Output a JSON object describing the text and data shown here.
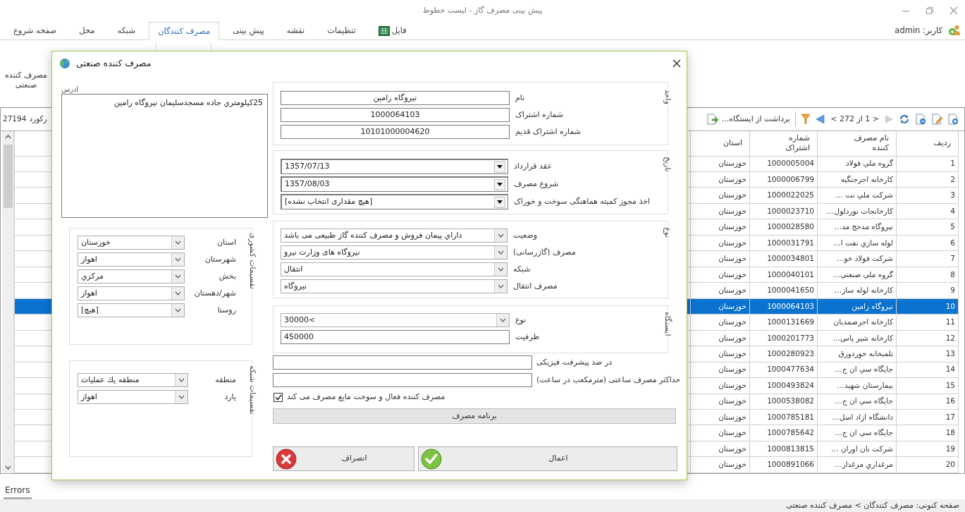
{
  "window": {
    "title": "پیش بینی مصرف گاز - لیست خطوط"
  },
  "ribbon_tabs": [
    {
      "label": "فایل",
      "kind": "file",
      "selected": false
    },
    {
      "label": "تنظیمات",
      "kind": "plain",
      "selected": false
    },
    {
      "label": "نقشه",
      "kind": "plain",
      "selected": false
    },
    {
      "label": "پیش بینی",
      "kind": "plain",
      "selected": false
    },
    {
      "label": "مصرف کنندگان",
      "kind": "plain",
      "selected": true
    },
    {
      "label": "شبکه",
      "kind": "plain",
      "selected": false
    },
    {
      "label": "محل",
      "kind": "plain",
      "selected": false
    },
    {
      "label": "صفحه شروع",
      "kind": "plain",
      "selected": false
    }
  ],
  "user": {
    "label": "کاربر: admin"
  },
  "ribbon_buttons": [
    {
      "label": "مصرف کننده صنعتی"
    }
  ],
  "grid": {
    "pager_text": "< 1 از 272 >",
    "action_label": "برداشت از ایستگاه...",
    "record_label": "رکورد",
    "record_count": "27194",
    "columns": [
      "ردیف",
      "نام مصرف کننده",
      "شماره اشتراک",
      "استان"
    ],
    "rows": [
      {
        "cells": [
          "1",
          "گروه  ملي فولاد",
          "1000005004",
          "خوزستان"
        ],
        "selected": false
      },
      {
        "cells": [
          "2",
          "كارخانه اجرجنگيه",
          "1000006799",
          "خوزستان"
        ],
        "selected": false
      },
      {
        "cells": [
          "3",
          "شركت  ملي نت …",
          "1000022025",
          "خوزستان"
        ],
        "selected": false
      },
      {
        "cells": [
          "4",
          "كارخانجات نوردلول…",
          "1000023710",
          "خوزستان"
        ],
        "selected": false
      },
      {
        "cells": [
          "5",
          "نيروگاه مدحج مد…",
          "1000028580",
          "خوزستان"
        ],
        "selected": false
      },
      {
        "cells": [
          "6",
          "لوله سازي نفت  ا…",
          "1000031791",
          "خوزستان"
        ],
        "selected": false
      },
      {
        "cells": [
          "7",
          "شركت   فولاد خو…",
          "1000034801",
          "خوزستان"
        ],
        "selected": false
      },
      {
        "cells": [
          "8",
          "گروه  ملي صنعتي…",
          "1000040101",
          "خوزستان"
        ],
        "selected": false
      },
      {
        "cells": [
          "9",
          "كارخانه لوله ساز…",
          "1000041650",
          "خوزستان"
        ],
        "selected": false
      },
      {
        "cells": [
          "10",
          "نيروگاه رامين",
          "1000064103",
          "خوزستان"
        ],
        "selected": true
      },
      {
        "cells": [
          "11",
          "كارخانه اجرصمديان",
          "1000131669",
          "خوزستان"
        ],
        "selected": false
      },
      {
        "cells": [
          "12",
          "كارخانه شير پاس…",
          "1000201773",
          "خوزستان"
        ],
        "selected": false
      },
      {
        "cells": [
          "13",
          "تلمبخانه خوردورق",
          "1000280923",
          "خوزستان"
        ],
        "selected": false
      },
      {
        "cells": [
          "14",
          "جايگاه سي ان ج…",
          "1000477634",
          "خوزستان"
        ],
        "selected": false
      },
      {
        "cells": [
          "15",
          "بيمارستان شهيد…",
          "1000493824",
          "خوزستان"
        ],
        "selected": false
      },
      {
        "cells": [
          "16",
          "جايگاه سي ان ج…",
          "1000538082",
          "خوزستان"
        ],
        "selected": false
      },
      {
        "cells": [
          "17",
          "دانشگاه ازاد اسل…",
          "1000785181",
          "خوزستان"
        ],
        "selected": false
      },
      {
        "cells": [
          "18",
          "جايگاه سي ان ج…",
          "1000785642",
          "خوزستان"
        ],
        "selected": false
      },
      {
        "cells": [
          "19",
          "شركت  نان اوران …",
          "1000813815",
          "خوزستان"
        ],
        "selected": false
      },
      {
        "cells": [
          "20",
          "مرغداري مرغدار…",
          "1000891066",
          "خوزستان"
        ],
        "selected": false
      }
    ]
  },
  "dialog": {
    "title": "مصرف کننده صنعتی",
    "address": {
      "label": "ادرس",
      "value": "25کيلومتري جاده مسجدسليمان نيروگاه رامين"
    },
    "region_groups": [
      {
        "caption": "تقسیمات کشوری",
        "fields": [
          {
            "label": "استان",
            "kind": "combo",
            "value": "خوزستان"
          },
          {
            "label": "شهرستان",
            "kind": "combo",
            "value": "اهواز"
          },
          {
            "label": "بخش",
            "kind": "combo",
            "value": "مرکزي"
          },
          {
            "label": "شهر/دهستان",
            "kind": "combo",
            "value": "اهواز"
          },
          {
            "label": "روستا",
            "kind": "combo",
            "value": "[هیچ]"
          }
        ]
      },
      {
        "caption": "تقسیمات شبکه",
        "fields": [
          {
            "label": "منطقه",
            "kind": "combo",
            "value": "منطقه يك عمليات"
          },
          {
            "label": "یارد",
            "kind": "combo",
            "value": "اهواز"
          }
        ]
      }
    ],
    "groups": [
      {
        "caption": "واحد",
        "fields": [
          {
            "label": "نام",
            "kind": "centered_text",
            "value": "نیروگاه رامین"
          },
          {
            "label": "شماره اشتراک",
            "kind": "centered_text",
            "value": "1000064103"
          },
          {
            "label": "شماره اشتراک قدیم",
            "kind": "centered_text",
            "value": "10101000004620"
          }
        ]
      },
      {
        "caption": "تاریخ",
        "fields": [
          {
            "label": "عقد قرارداد",
            "kind": "date",
            "value": "1357/07/13"
          },
          {
            "label": "شروع مصرف",
            "kind": "date",
            "value": "1357/08/03"
          },
          {
            "label": "اخذ مجوز کمیته هماهنگی سوخت و خوراک",
            "kind": "date",
            "value": "[هیچ مقداری انتخاب نشده]"
          }
        ]
      },
      {
        "caption": "نوع",
        "fields": [
          {
            "label": "وضعیت",
            "kind": "combo",
            "value": "داراي پیمان فروش و مصرف کننده گاز طبیعی می باشد"
          },
          {
            "label": "مصرف (گازرسانی)",
            "kind": "combo",
            "value": "نیروگاه های وزارت نیرو"
          },
          {
            "label": "شبکه",
            "kind": "combo",
            "value": "انتقال"
          },
          {
            "label": "مصرف انتقال",
            "kind": "combo",
            "value": "نیروگاه"
          }
        ]
      },
      {
        "caption": "ایستگاه",
        "fields": [
          {
            "label": "نوع",
            "kind": "combo",
            "value": "30000<"
          },
          {
            "label": "ظرفیت",
            "kind": "text",
            "value": "450000"
          }
        ]
      }
    ],
    "extra_fields": [
      {
        "label": "در صد پیشرفت فیزیکی"
      },
      {
        "label": "حداکثر مصرف ساعتی (مترمکعب در ساعت)"
      }
    ],
    "checkbox": {
      "label": "مصرف کننده فعال و سوخت مایع مصرف می کند",
      "checked": true
    },
    "schedule_button": "برنامه مصرف",
    "buttons": [
      {
        "label": "اعمال",
        "kind": "apply"
      },
      {
        "label": "انصراف",
        "kind": "cancel"
      }
    ]
  },
  "bottom_tabs": [
    {
      "label": "Errors",
      "selected": true
    }
  ],
  "status_bar": "صفحه کنونی: مصرف کنندگان > مصرف کننده صنعتی"
}
